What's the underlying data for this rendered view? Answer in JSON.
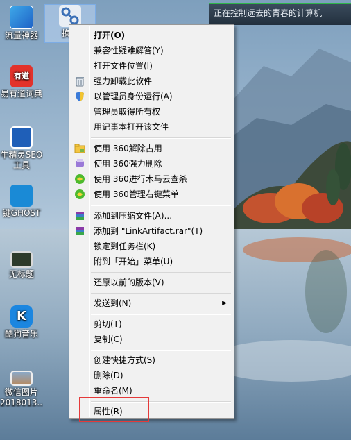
{
  "desktop": {
    "icons": [
      {
        "label": "流量神器"
      },
      {
        "label": "换链"
      },
      {
        "label": "易有道词典"
      },
      {
        "label": "牛精灵SEO"
      },
      {
        "label": "工具"
      },
      {
        "label": "键GHOST"
      },
      {
        "label": "无标题"
      },
      {
        "label": "酷狗音乐"
      },
      {
        "label": "微信图片"
      },
      {
        "label": "2018013..."
      }
    ]
  },
  "notification": {
    "text": "正在控制远去的青春的计算机"
  },
  "context_menu": {
    "items": {
      "open": "打开(O)",
      "compat": "兼容性疑难解答(Y)",
      "open_location": "打开文件位置(I)",
      "force_uninstall": "强力卸载此软件",
      "run_as_admin": "以管理员身份运行(A)",
      "take_ownership": "管理员取得所有权",
      "open_notepad": "用记事本打开该文件",
      "unlock_360": "使用 360解除占用",
      "force_delete_360": "使用 360强力删除",
      "trojan_scan_360": "使用 360进行木马云查杀",
      "manage_menu_360": "使用 360管理右键菜单",
      "add_archive": "添加到压缩文件(A)...",
      "add_to_rar": "添加到 \"LinkArtifact.rar\"(T)",
      "pin_taskbar": "锁定到任务栏(K)",
      "pin_start": "附到「开始」菜单(U)",
      "restore_prev": "还原以前的版本(V)",
      "send_to": "发送到(N)",
      "cut": "剪切(T)",
      "copy": "复制(C)",
      "create_shortcut": "创建快捷方式(S)",
      "delete": "删除(D)",
      "rename": "重命名(M)",
      "properties": "属性(R)"
    }
  },
  "colors": {
    "highlight_border": "#e53a3a",
    "menu_bg": "#f1f1f1",
    "tip_accent": "#2fb44a"
  }
}
